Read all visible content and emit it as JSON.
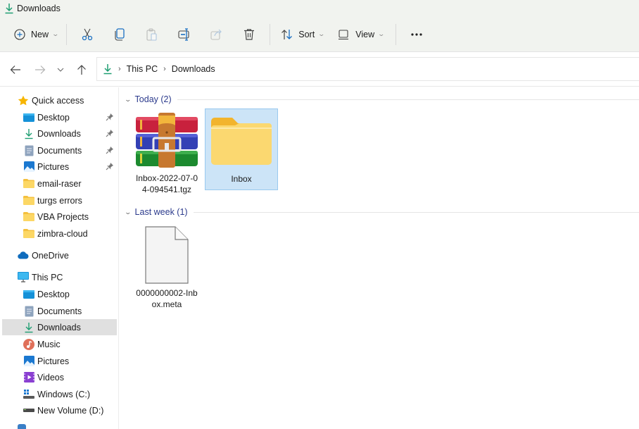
{
  "window": {
    "title": "Downloads",
    "title_icon": "download-arrow-icon"
  },
  "toolbar": {
    "new_label": "New",
    "items": [
      {
        "name": "new",
        "label": "New",
        "icon": "plus-circle-icon"
      },
      {
        "name": "cut",
        "icon": "scissors-icon"
      },
      {
        "name": "copy",
        "icon": "copy-icon"
      },
      {
        "name": "paste",
        "icon": "paste-icon",
        "disabled": true
      },
      {
        "name": "rename",
        "icon": "rename-icon"
      },
      {
        "name": "share",
        "icon": "share-icon",
        "disabled": true
      },
      {
        "name": "delete",
        "icon": "trash-icon"
      },
      {
        "name": "sort",
        "label": "Sort",
        "icon": "sort-arrows-icon"
      },
      {
        "name": "view",
        "label": "View",
        "icon": "monitor-icon"
      },
      {
        "name": "more",
        "icon": "more-dots-icon"
      }
    ],
    "sort_label": "Sort",
    "view_label": "View"
  },
  "address_bar": {
    "location_icon": "download-arrow-icon",
    "breadcrumbs": [
      "This PC",
      "Downloads"
    ]
  },
  "sidebar": {
    "quick_access": {
      "label": "Quick access",
      "items": [
        {
          "label": "Desktop",
          "icon": "desktop-icon",
          "pinned": true
        },
        {
          "label": "Downloads",
          "icon": "download-arrow-icon",
          "pinned": true
        },
        {
          "label": "Documents",
          "icon": "documents-icon",
          "pinned": true
        },
        {
          "label": "Pictures",
          "icon": "pictures-icon",
          "pinned": true
        },
        {
          "label": "email-raser",
          "icon": "folder-icon"
        },
        {
          "label": "turgs errors",
          "icon": "folder-icon"
        },
        {
          "label": "VBA Projects",
          "icon": "folder-icon"
        },
        {
          "label": "zimbra-cloud",
          "icon": "folder-icon"
        }
      ]
    },
    "onedrive": {
      "label": "OneDrive",
      "icon": "cloud-icon"
    },
    "this_pc": {
      "label": "This PC",
      "items": [
        {
          "label": "Desktop",
          "icon": "desktop-icon"
        },
        {
          "label": "Documents",
          "icon": "documents-icon"
        },
        {
          "label": "Downloads",
          "icon": "download-arrow-icon",
          "selected": true
        },
        {
          "label": "Music",
          "icon": "music-icon"
        },
        {
          "label": "Pictures",
          "icon": "pictures-icon"
        },
        {
          "label": "Videos",
          "icon": "videos-icon"
        },
        {
          "label": "Windows (C:)",
          "icon": "windows-drive-icon"
        },
        {
          "label": "New Volume (D:)",
          "icon": "drive-icon"
        }
      ]
    }
  },
  "content": {
    "groups": [
      {
        "header": "Today (2)",
        "files": [
          {
            "name": "Inbox-2022-07-04-094541.tgz",
            "name_line1": "Inbox-2022-07-0",
            "name_line2": "4-094541.tgz",
            "icon": "archive-icon"
          },
          {
            "name": "Inbox",
            "name_line1": "Inbox",
            "icon": "folder-icon",
            "selected": true
          }
        ]
      },
      {
        "header": "Last week (1)",
        "files": [
          {
            "name": "0000000002-Inbox.meta",
            "name_line1": "0000000002-Inb",
            "name_line2": "ox.meta",
            "icon": "blank-file-icon"
          }
        ]
      }
    ]
  },
  "colors": {
    "accent_green": "#1e9e72",
    "group_header_text": "#2b3a8c",
    "selection_bg": "#cce4f7",
    "sidebar_selected_bg": "#e0e0e0",
    "toolbar_bg": "#f1f3ef"
  }
}
